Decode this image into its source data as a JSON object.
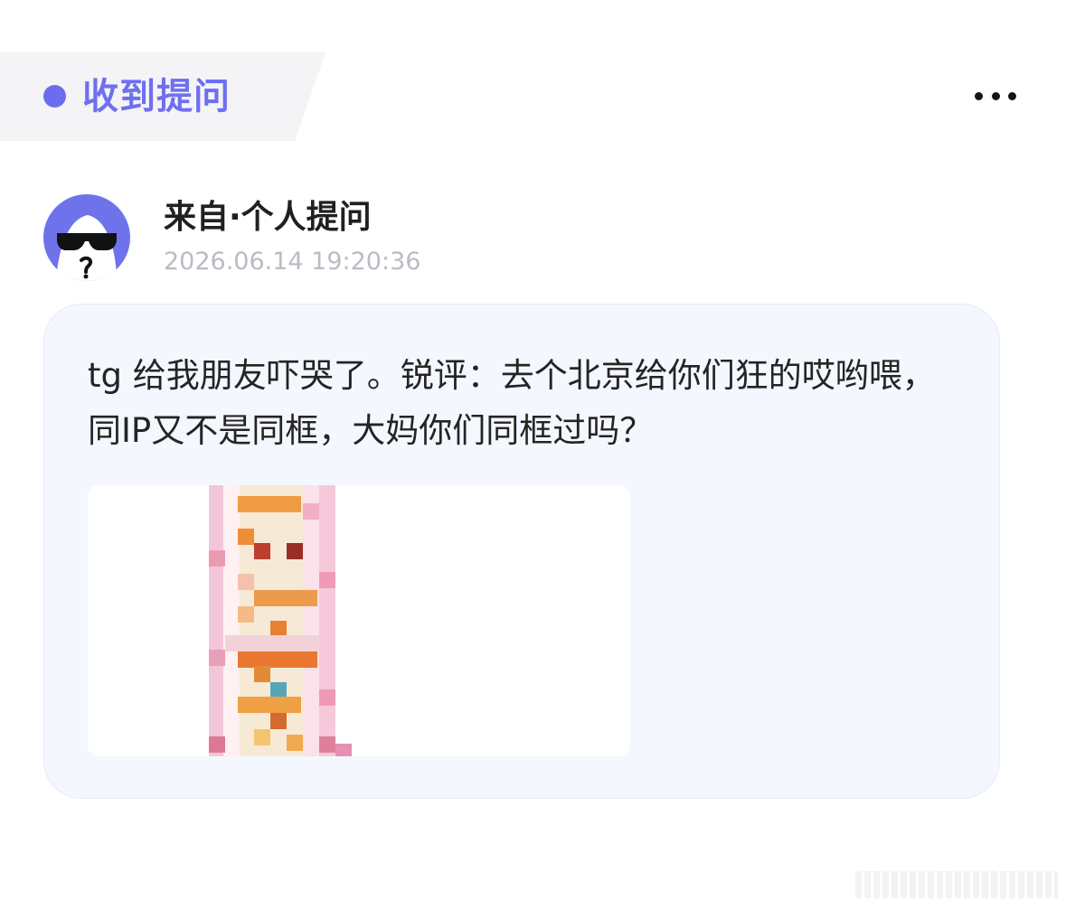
{
  "header": {
    "title": "收到提问",
    "accent_color": "#6f6ff1",
    "more_icon": "more-horizontal-icon"
  },
  "sender": {
    "avatar_icon": "sunglasses-face-avatar-icon",
    "title": "来自·个人提问",
    "timestamp": "2026.06.14 19:20:36"
  },
  "message": {
    "text": "tg 给我朋友吓哭了。锐评：去个北京给你们狂的哎哟喂，同IP又不是同框，大妈你们同框过吗？",
    "image": "pixelated-photo-image"
  },
  "colors": {
    "card_background": "#f4f7fd",
    "avatar_background": "#6e73ec",
    "timestamp": "#b9bcc4"
  }
}
